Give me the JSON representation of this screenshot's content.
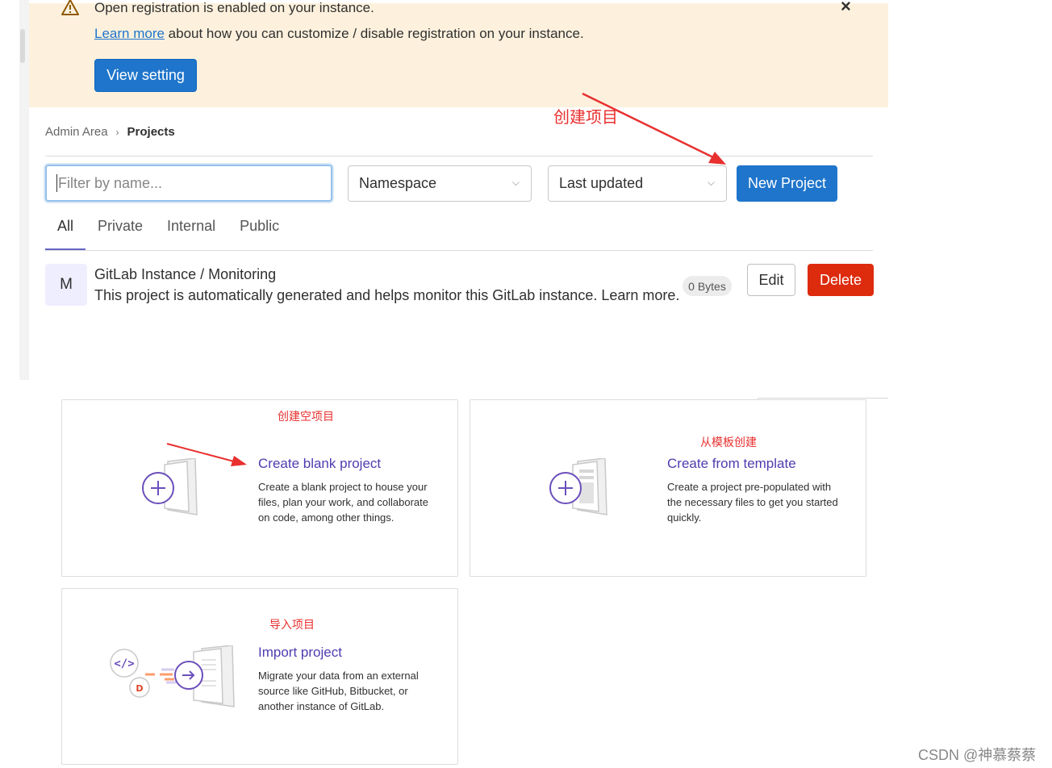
{
  "banner": {
    "title": "Open registration is enabled on your instance.",
    "link": "Learn more",
    "desc_rest": " about how you can customize / disable registration on your instance.",
    "button": "View setting",
    "close": "×"
  },
  "breadcrumb": {
    "parent": "Admin Area",
    "separator": "›",
    "current": "Projects"
  },
  "filters": {
    "search_placeholder": "Filter by name...",
    "namespace": "Namespace",
    "sort": "Last updated",
    "new_project": "New Project"
  },
  "tabs": [
    "All",
    "Private",
    "Internal",
    "Public"
  ],
  "project": {
    "avatar": "M",
    "name": "GitLab Instance / Monitoring",
    "description": "This project is automatically generated and helps monitor this GitLab instance. Learn more.",
    "size": "0 Bytes",
    "edit": "Edit",
    "delete": "Delete"
  },
  "annotations": {
    "create_project": "创建项目",
    "create_blank": "创建空项目",
    "from_template": "从模板创建",
    "import": "导入项目"
  },
  "cards": {
    "blank": {
      "title": "Create blank project",
      "lines": [
        "Create a blank project to house your",
        "files, plan your work, and collaborate",
        "on code, among other things."
      ]
    },
    "template": {
      "title": "Create from template",
      "lines": [
        "Create a project pre-populated with",
        "the necessary files to get you started",
        "quickly."
      ]
    },
    "import": {
      "title": "Import project",
      "lines": [
        "Migrate your data from an external",
        "source like GitHub, Bitbucket, or",
        "another instance of GitLab."
      ]
    }
  },
  "watermark": "CSDN @神慕蔡蔡",
  "colors": {
    "accent": "#1f75cb",
    "danger": "#dd2b0e",
    "banner_bg": "#fdf1dd",
    "annotation": "#e8302f",
    "card_title": "#4f3cb0"
  }
}
